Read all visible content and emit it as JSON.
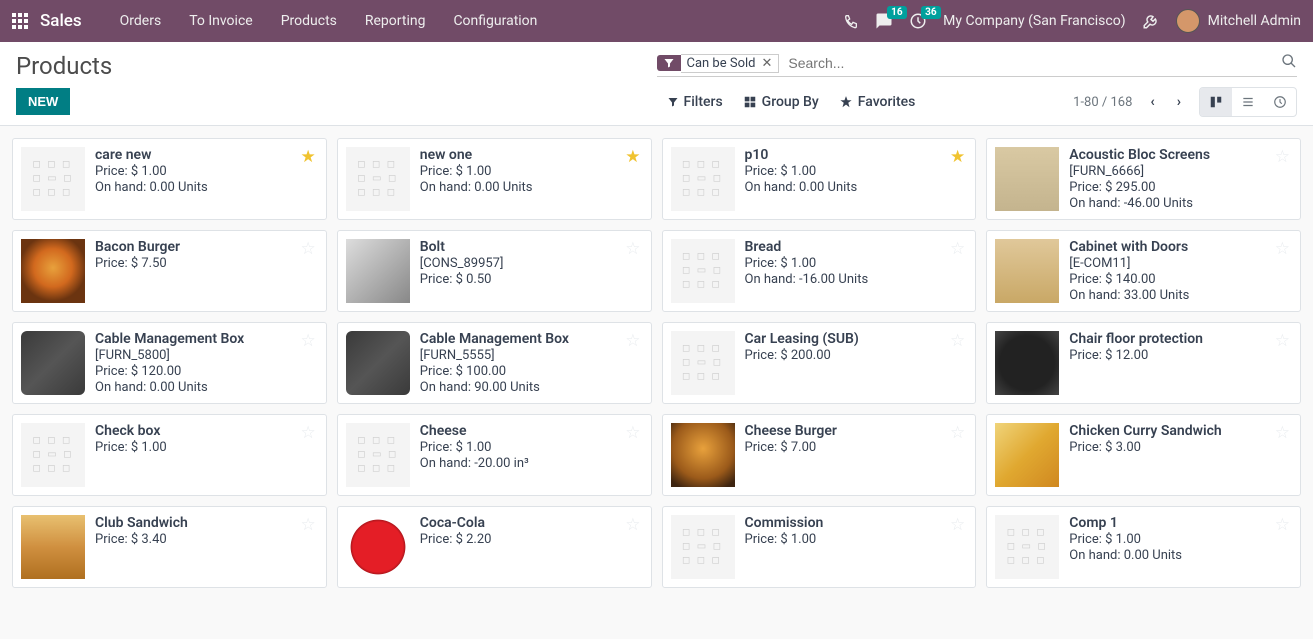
{
  "nav": {
    "brand": "Sales",
    "menu": [
      "Orders",
      "To Invoice",
      "Products",
      "Reporting",
      "Configuration"
    ],
    "msg_count": "16",
    "act_count": "36",
    "company": "My Company (San Francisco)",
    "user": "Mitchell Admin"
  },
  "header": {
    "breadcrumb": "Products",
    "new": "NEW"
  },
  "search": {
    "facet_label": "Can be Sold",
    "placeholder": "Search..."
  },
  "toolbar": {
    "filters": "Filters",
    "group": "Group By",
    "fav": "Favorites",
    "pager": "1-80 / 168"
  },
  "price_label": "Price: ",
  "onhand_label": "On hand: ",
  "products": [
    {
      "name": "care new",
      "price": "$ 1.00",
      "onhand": "0.00 Units",
      "thumb": "placeholder",
      "fav": true
    },
    {
      "name": "new one",
      "price": "$ 1.00",
      "onhand": "0.00 Units",
      "thumb": "placeholder",
      "fav": true
    },
    {
      "name": "p10",
      "price": "$ 1.00",
      "onhand": "0.00 Units",
      "thumb": "placeholder",
      "fav": true
    },
    {
      "name": "Acoustic Bloc Screens",
      "ref": "[FURN_6666]",
      "price": "$ 295.00",
      "onhand": "-46.00 Units",
      "thumb": "t-screen",
      "fav": false
    },
    {
      "name": "Bacon Burger",
      "price": "$ 7.50",
      "thumb": "t-burger",
      "fav": false
    },
    {
      "name": "Bolt",
      "ref": "[CONS_89957]",
      "price": "$ 0.50",
      "thumb": "t-bolt",
      "fav": false
    },
    {
      "name": "Bread",
      "price": "$ 1.00",
      "onhand": "-16.00 Units",
      "thumb": "placeholder",
      "fav": false
    },
    {
      "name": "Cabinet with Doors",
      "ref": "[E-COM11]",
      "price": "$ 140.00",
      "onhand": "33.00 Units",
      "thumb": "t-cabinet",
      "fav": false
    },
    {
      "name": "Cable Management Box",
      "ref": "[FURN_5800]",
      "price": "$ 120.00",
      "onhand": "0.00 Units",
      "thumb": "t-cablebox",
      "fav": false
    },
    {
      "name": "Cable Management Box",
      "ref": "[FURN_5555]",
      "price": "$ 100.00",
      "onhand": "90.00 Units",
      "thumb": "t-cablebox",
      "fav": false
    },
    {
      "name": "Car Leasing (SUB)",
      "price": "$ 200.00",
      "thumb": "placeholder",
      "fav": false
    },
    {
      "name": "Chair floor protection",
      "price": "$ 12.00",
      "thumb": "t-mat",
      "fav": false
    },
    {
      "name": "Check box",
      "price": "$ 1.00",
      "thumb": "placeholder",
      "fav": false
    },
    {
      "name": "Cheese",
      "price": "$ 1.00",
      "onhand": "-20.00 in³",
      "thumb": "placeholder",
      "fav": false
    },
    {
      "name": "Cheese Burger",
      "price": "$ 7.00",
      "thumb": "t-cheeseburger",
      "fav": false
    },
    {
      "name": "Chicken Curry Sandwich",
      "price": "$ 3.00",
      "thumb": "t-sandwich",
      "fav": false
    },
    {
      "name": "Club Sandwich",
      "price": "$ 3.40",
      "thumb": "t-club",
      "fav": false
    },
    {
      "name": "Coca-Cola",
      "price": "$ 2.20",
      "thumb": "t-coke",
      "fav": false
    },
    {
      "name": "Commission",
      "price": "$ 1.00",
      "thumb": "placeholder",
      "fav": false
    },
    {
      "name": "Comp 1",
      "price": "$ 1.00",
      "onhand": "0.00 Units",
      "thumb": "placeholder",
      "fav": false
    }
  ]
}
